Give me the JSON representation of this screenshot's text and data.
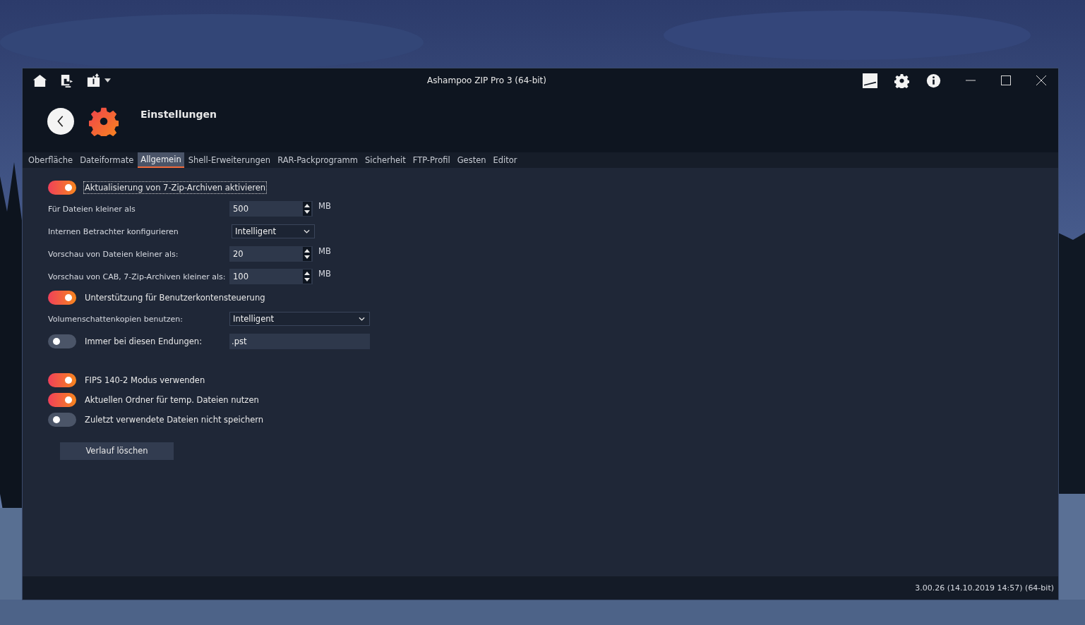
{
  "window": {
    "title": "Ashampoo ZIP Pro 3 (64-bit)"
  },
  "header": {
    "title": "Einstellungen"
  },
  "tabs": [
    {
      "label": "Oberfläche",
      "selected": false
    },
    {
      "label": "Dateiformate",
      "selected": false
    },
    {
      "label": "Allgemein",
      "selected": true
    },
    {
      "label": "Shell-Erweiterungen",
      "selected": false
    },
    {
      "label": "RAR-Packprogramm",
      "selected": false
    },
    {
      "label": "Sicherheit",
      "selected": false
    },
    {
      "label": "FTP-Profil",
      "selected": false
    },
    {
      "label": "Gesten",
      "selected": false
    },
    {
      "label": "Editor",
      "selected": false
    }
  ],
  "settings": [
    {
      "kind": "toggle",
      "label": "Aktualisierung von 7-Zip-Archiven aktivieren",
      "on": true,
      "focused": true
    },
    {
      "kind": "spin",
      "label": "Für Dateien kleiner als",
      "value": "500",
      "unit": "MB"
    },
    {
      "kind": "select",
      "label": "Internen Betrachter konfigurieren",
      "value": "Intelligent",
      "wide": false
    },
    {
      "kind": "spin",
      "label": "Vorschau von Dateien kleiner als:",
      "value": "20",
      "unit": "MB"
    },
    {
      "kind": "spin",
      "label": "Vorschau von CAB, 7-Zip-Archiven kleiner als:",
      "value": "100",
      "unit": "MB"
    },
    {
      "kind": "toggle",
      "label": "Unterstützung für Benutzerkontensteuerung",
      "on": true,
      "focused": false
    },
    {
      "kind": "select",
      "label": "Volumenschattenkopien benutzen:",
      "value": "Intelligent",
      "wide": true
    },
    {
      "kind": "toggle_field",
      "label": "Immer bei diesen Endungen:",
      "on": false,
      "value": ".pst"
    },
    {
      "kind": "gap"
    },
    {
      "kind": "toggle",
      "label": "FIPS 140-2 Modus verwenden",
      "on": true,
      "focused": false
    },
    {
      "kind": "toggle",
      "label": "Aktuellen Ordner für temp. Dateien nutzen",
      "on": true,
      "focused": false
    },
    {
      "kind": "toggle",
      "label": "Zuletzt verwendete Dateien nicht speichern",
      "on": false,
      "focused": false
    },
    {
      "kind": "button",
      "label": "Verlauf löschen"
    }
  ],
  "status_bar": {
    "version": "3.00.26 (14.10.2019 14:57) (64-bit)"
  }
}
